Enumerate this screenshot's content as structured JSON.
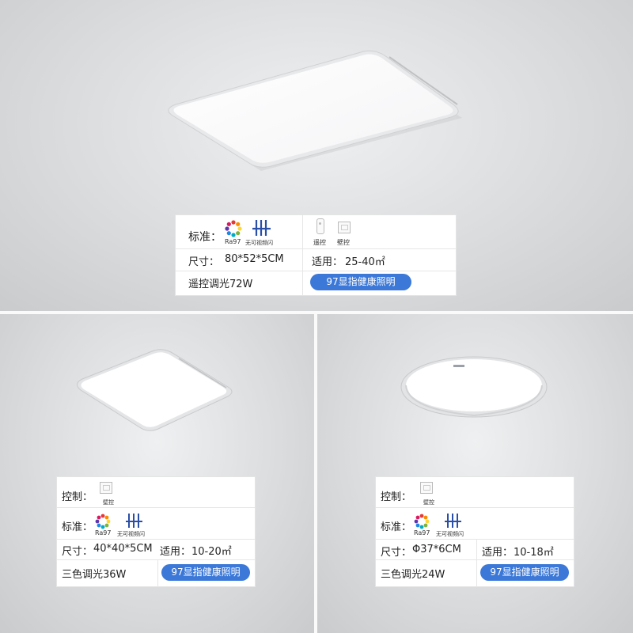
{
  "top": {
    "standard_label": "标准：",
    "ra_label": "Ra97",
    "flicker_label": "无可视频闪",
    "remote_label": "遥控",
    "wall_label": "壁控",
    "size_label": "尺寸：",
    "size_value": "80*52*5CM",
    "area_label": "适用：",
    "area_value": "25-40㎡",
    "dimming": "遥控调光72W",
    "badge": "97显指健康照明"
  },
  "bottom_left": {
    "control_label": "控制：",
    "wall_label": "壁控",
    "standard_label": "标准：",
    "ra_label": "Ra97",
    "flicker_label": "无可视频闪",
    "size_label": "尺寸：",
    "size_value": "40*40*5CM",
    "area_label": "适用：",
    "area_value": "10-20㎡",
    "dimming": "三色调光36W",
    "badge": "97显指健康照明"
  },
  "bottom_right": {
    "control_label": "控制：",
    "wall_label": "壁控",
    "standard_label": "标准：",
    "ra_label": "Ra97",
    "flicker_label": "无可视频闪",
    "size_label": "尺寸：",
    "size_value": "Φ37*6CM",
    "area_label": "适用：",
    "area_value": "10-18㎡",
    "dimming": "三色调光24W",
    "badge": "97显指健康照明"
  },
  "colors": {
    "badge": "#3b78d8",
    "flicker_icon": "#2a4fa8",
    "background": "#d9dbdd"
  }
}
